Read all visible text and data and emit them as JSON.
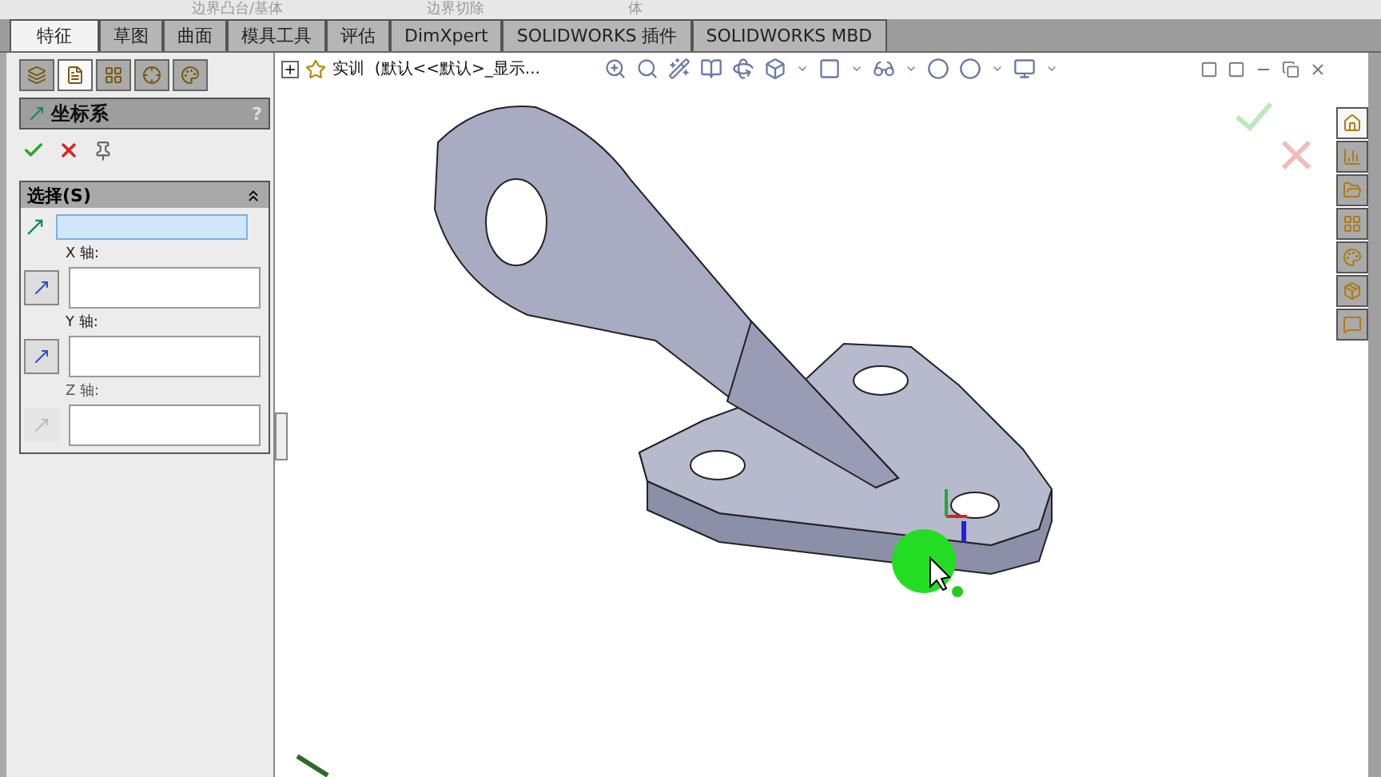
{
  "top_toolbar": [
    {
      "label": "边界凸台/基体"
    },
    {
      "label": "边界切除"
    },
    {
      "label": "体"
    }
  ],
  "tabs": [
    {
      "label": "特征",
      "selected": true
    },
    {
      "label": "草图",
      "selected": false
    },
    {
      "label": "曲面",
      "selected": false
    },
    {
      "label": "模具工具",
      "selected": false
    },
    {
      "label": "评估",
      "selected": false
    },
    {
      "label": "DimXpert",
      "selected": false
    },
    {
      "label": "SOLIDWORKS 插件",
      "selected": false
    },
    {
      "label": "SOLIDWORKS MBD",
      "selected": false
    }
  ],
  "panel_tabs": [
    {
      "selected": false
    },
    {
      "selected": true
    },
    {
      "selected": false
    },
    {
      "selected": false
    },
    {
      "selected": false
    }
  ],
  "property_manager": {
    "title": "坐标系",
    "help": "?",
    "section": {
      "title": "选择(S)",
      "expanded": true,
      "fields": [
        {
          "kind": "origin",
          "active": true
        },
        {
          "kind": "axis",
          "label": "X 轴:",
          "active": false,
          "disabled": false
        },
        {
          "kind": "axis",
          "label": "Y 轴:",
          "active": false,
          "disabled": false
        },
        {
          "kind": "axis",
          "label": "Z 轴:",
          "active": false,
          "disabled": true
        }
      ]
    }
  },
  "tree": {
    "label": "实训  (默认<<默认>_显示..."
  },
  "task_pane": [
    {
      "selected": true
    },
    {
      "selected": false
    },
    {
      "selected": false
    },
    {
      "selected": false
    },
    {
      "selected": false
    },
    {
      "selected": false
    },
    {
      "selected": false
    }
  ]
}
